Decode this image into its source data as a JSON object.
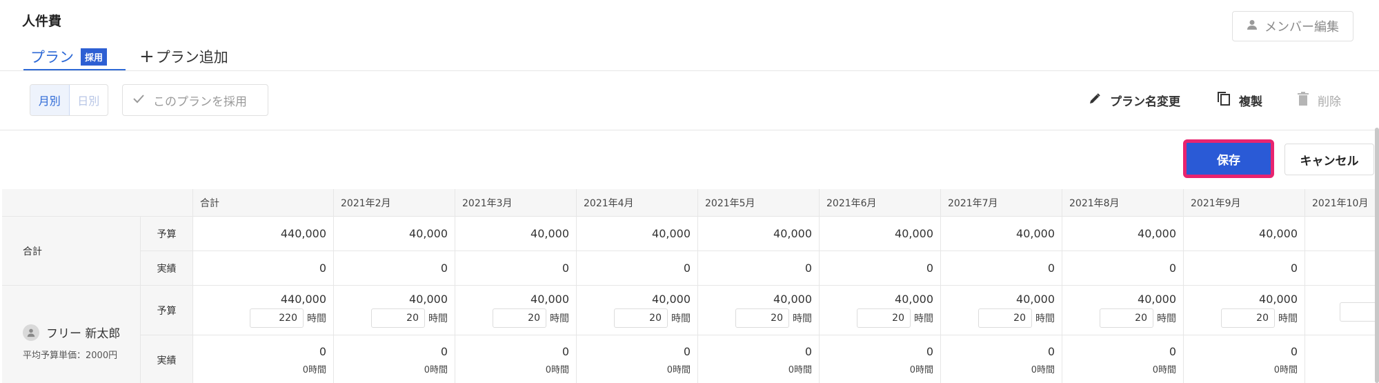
{
  "header": {
    "title": "人件費",
    "member_edit": "メンバー編集"
  },
  "tabs": {
    "plan_label": "プラン",
    "plan_badge": "採用",
    "add_label": "プラン追加"
  },
  "toolbar": {
    "month": "月別",
    "day": "日別",
    "adopt": "このプランを採用",
    "rename": "プラン名変更",
    "duplicate": "複製",
    "delete": "削除",
    "save": "保存",
    "cancel": "キャンセル"
  },
  "table": {
    "columns": [
      "合計",
      "2021年2月",
      "2021年3月",
      "2021年4月",
      "2021年5月",
      "2021年6月",
      "2021年7月",
      "2021年8月",
      "2021年9月",
      "2021年10月"
    ],
    "total_label": "合計",
    "budget_label": "予算",
    "actual_label": "実績",
    "total_budget": [
      "440,000",
      "40,000",
      "40,000",
      "40,000",
      "40,000",
      "40,000",
      "40,000",
      "40,000",
      "40,000",
      ""
    ],
    "total_actual": [
      "0",
      "0",
      "0",
      "0",
      "0",
      "0",
      "0",
      "0",
      "0",
      ""
    ],
    "member": {
      "name": "フリー 新太郎",
      "unit_price": "平均予算単価：2000円",
      "budget": [
        "440,000",
        "40,000",
        "40,000",
        "40,000",
        "40,000",
        "40,000",
        "40,000",
        "40,000",
        "40,000",
        ""
      ],
      "hours": [
        "220",
        "20",
        "20",
        "20",
        "20",
        "20",
        "20",
        "20",
        "20",
        ""
      ],
      "hour_unit": "時間",
      "actual": [
        "0",
        "0",
        "0",
        "0",
        "0",
        "0",
        "0",
        "0",
        "0",
        ""
      ],
      "actual_hours": [
        "0時間",
        "0時間",
        "0時間",
        "0時間",
        "0時間",
        "0時間",
        "0時間",
        "0時間",
        "0時間",
        ""
      ]
    }
  },
  "colors": {
    "accent": "#2d69d6",
    "save": "#2a5ad6",
    "highlight": "#e8246f"
  }
}
